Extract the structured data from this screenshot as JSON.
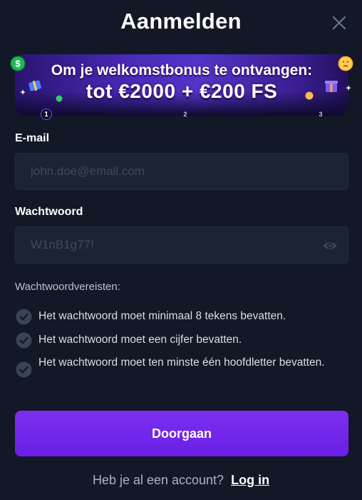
{
  "header": {
    "title": "Aanmelden"
  },
  "banner": {
    "line1": "Om je welkomstbonus te ontvangen:",
    "line2": "tot €2000 + €200 FS",
    "steps": [
      "1",
      "2",
      "3"
    ],
    "active_step": 1
  },
  "email": {
    "label": "E-mail",
    "placeholder": "john.doe@email.com",
    "value": ""
  },
  "password": {
    "label": "Wachtwoord",
    "placeholder": "W1nB1g77!",
    "value": ""
  },
  "requirements": {
    "title": "Wachtwoordvereisten:",
    "items": [
      "Het wachtwoord moet minimaal 8 tekens bevatten.",
      "Het wachtwoord moet een cijfer bevatten.",
      "Het wachtwoord moet ten minste één hoofdletter bevatten."
    ]
  },
  "submit": {
    "label": "Doorgaan"
  },
  "footer": {
    "prompt": "Heb je al een account?",
    "login_label": "Log in"
  },
  "colors": {
    "background": "#121826",
    "input_bg": "#1b2433",
    "accent": "#7b2ff0",
    "banner": "#4a2ab8",
    "check_circle": "#3a4455"
  }
}
